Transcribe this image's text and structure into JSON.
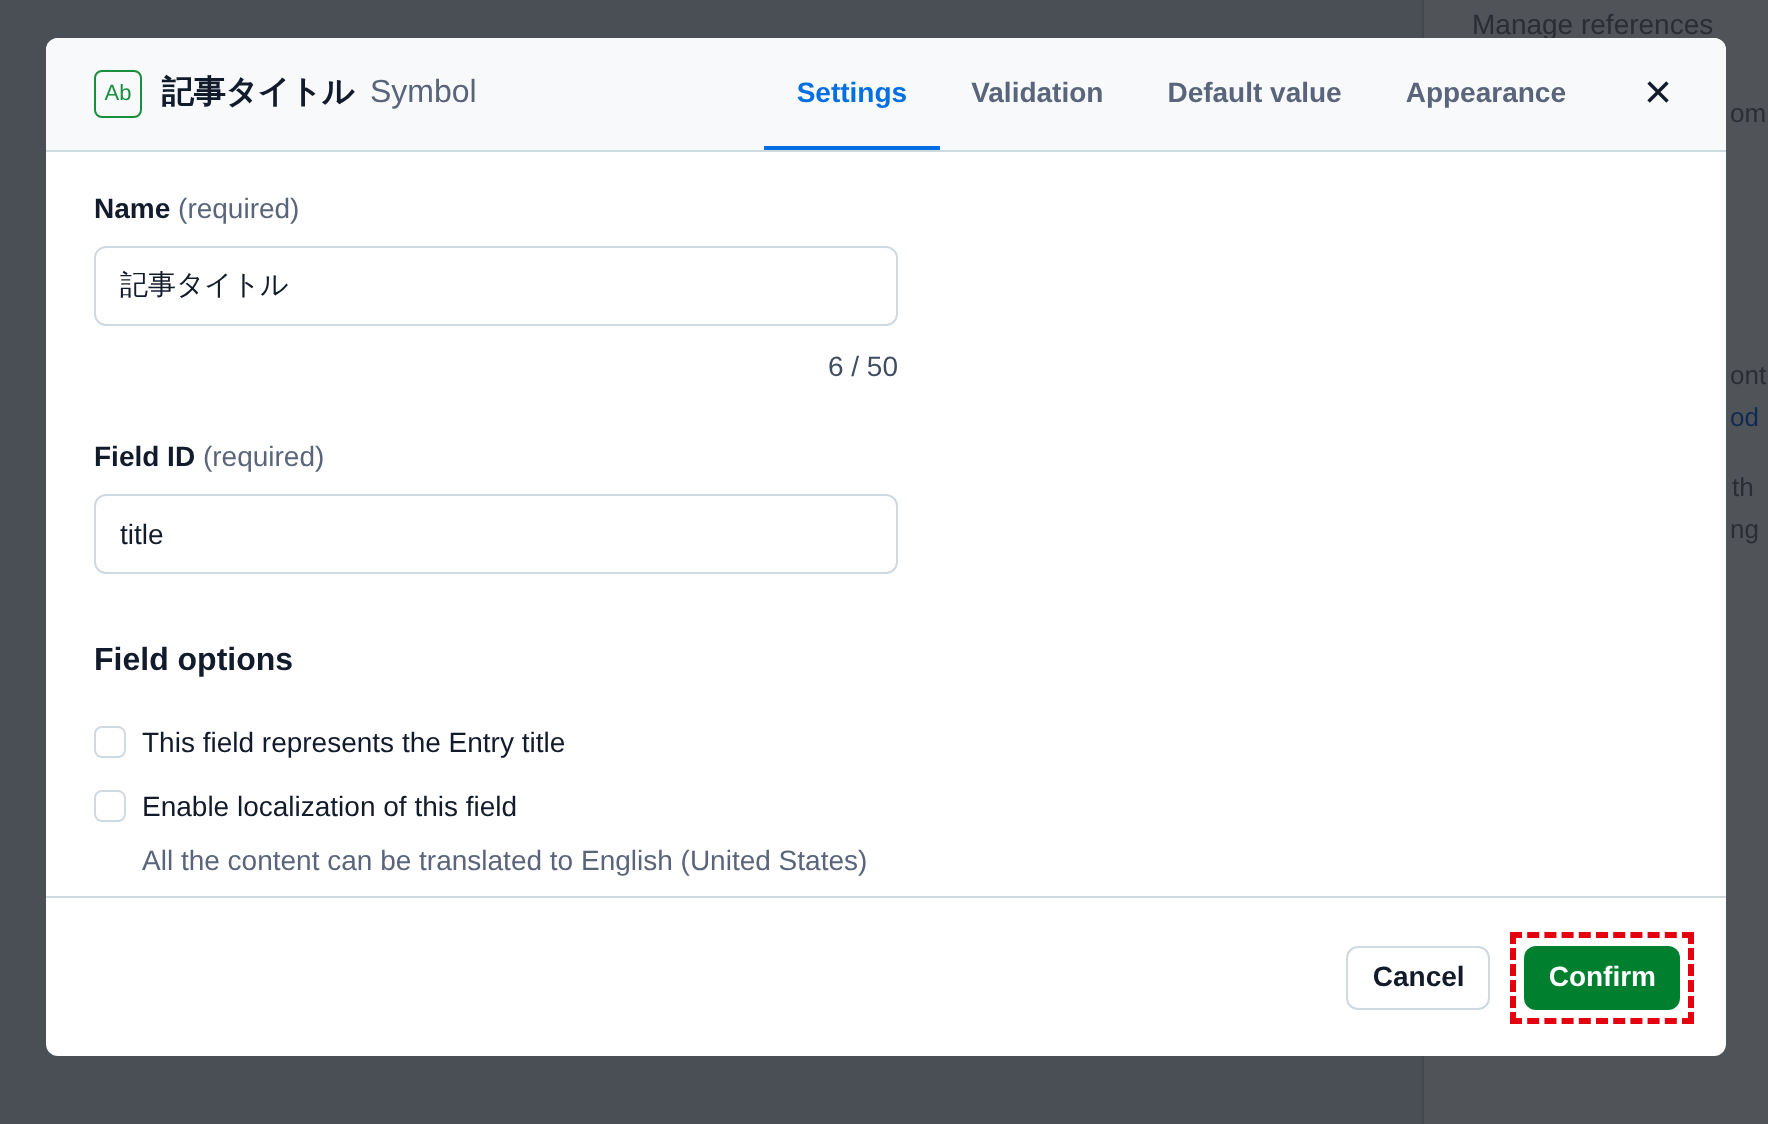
{
  "background_panel": {
    "texts": [
      {
        "text": "Manage references",
        "kind": "heading"
      },
      {
        "text": "om",
        "kind": "text"
      },
      {
        "text": "ont",
        "kind": "text"
      },
      {
        "text": "od",
        "kind": "link"
      },
      {
        "text": "th",
        "kind": "text"
      },
      {
        "text": "ng",
        "kind": "text"
      }
    ]
  },
  "dialog": {
    "type_badge": "Ab",
    "title": "記事タイトル",
    "subtitle": "Symbol",
    "tabs": [
      {
        "label": "Settings",
        "selected": true
      },
      {
        "label": "Validation",
        "selected": false
      },
      {
        "label": "Default value",
        "selected": false
      },
      {
        "label": "Appearance",
        "selected": false
      }
    ],
    "close": "×",
    "fields": [
      {
        "label": "Name",
        "hint": "(required)",
        "value": "記事タイトル",
        "counter": "6 / 50"
      },
      {
        "label": "Field ID",
        "hint": "(required)",
        "value": "title"
      }
    ],
    "options_heading": "Field options",
    "options": [
      {
        "label": "This field represents the Entry title",
        "checked": false
      },
      {
        "label": "Enable localization of this field",
        "checked": false,
        "help": "All the content can be translated to English (United States)"
      }
    ],
    "buttons": [
      {
        "label": "Cancel",
        "kind": "secondary",
        "highlighted": false
      },
      {
        "label": "Confirm",
        "kind": "primary",
        "highlighted": true
      }
    ]
  }
}
